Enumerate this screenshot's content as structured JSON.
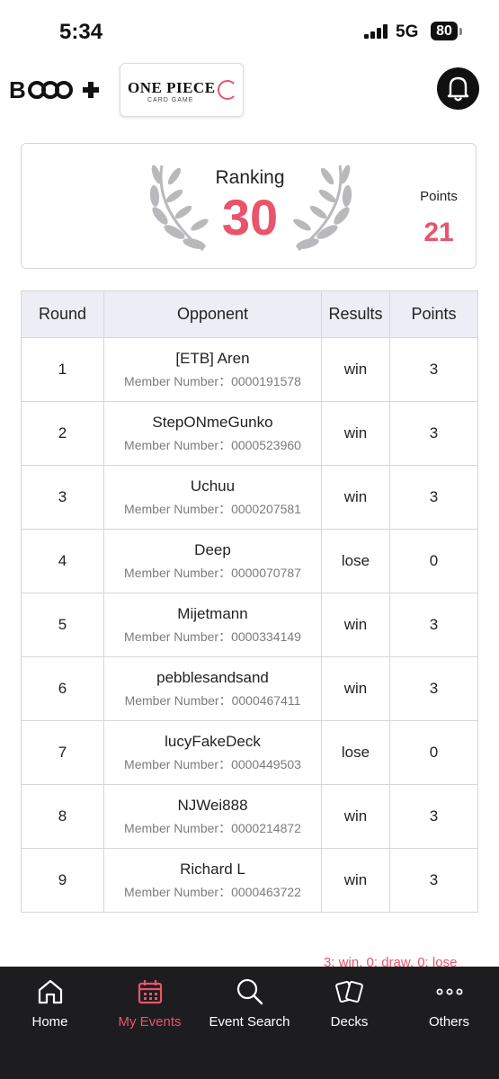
{
  "status_bar": {
    "time": "5:34",
    "network": "5G",
    "battery": "80"
  },
  "header": {
    "brand_logo": "B+",
    "game_logo_title": "ONE PIECE",
    "game_logo_subtitle": "CARD GAME"
  },
  "ranking": {
    "label": "Ranking",
    "value": "30",
    "points_label": "Points",
    "points_value": "21"
  },
  "table": {
    "headers": [
      "Round",
      "Opponent",
      "Results",
      "Points"
    ],
    "rows": [
      {
        "round": "1",
        "name": "[ETB] Aren",
        "member": "Member Number：0000191578",
        "result": "win",
        "points": "3"
      },
      {
        "round": "2",
        "name": "StepONmeGunko",
        "member": "Member Number：0000523960",
        "result": "win",
        "points": "3"
      },
      {
        "round": "3",
        "name": "Uchuu",
        "member": "Member Number：0000207581",
        "result": "win",
        "points": "3"
      },
      {
        "round": "4",
        "name": "Deep",
        "member": "Member Number：0000070787",
        "result": "lose",
        "points": "0"
      },
      {
        "round": "5",
        "name": "Mijetmann",
        "member": "Member Number：0000334149",
        "result": "win",
        "points": "3"
      },
      {
        "round": "6",
        "name": "pebblesandsand",
        "member": "Member Number：0000467411",
        "result": "win",
        "points": "3"
      },
      {
        "round": "7",
        "name": "lucyFakeDeck",
        "member": "Member Number：0000449503",
        "result": "lose",
        "points": "0"
      },
      {
        "round": "8",
        "name": "NJWei888",
        "member": "Member Number：0000214872",
        "result": "win",
        "points": "3"
      },
      {
        "round": "9",
        "name": "Richard L",
        "member": "Member Number：0000463722",
        "result": "win",
        "points": "3"
      }
    ]
  },
  "footnote": "3: win, 0: draw, 0: lose",
  "nav": {
    "home": "Home",
    "my_events": "My Events",
    "event_search": "Event Search",
    "decks": "Decks",
    "others": "Others"
  },
  "colors": {
    "accent": "#e9546b",
    "nav_bg": "#1d1d20",
    "header_bg": "#ededf5",
    "border": "#d6d6dc"
  }
}
